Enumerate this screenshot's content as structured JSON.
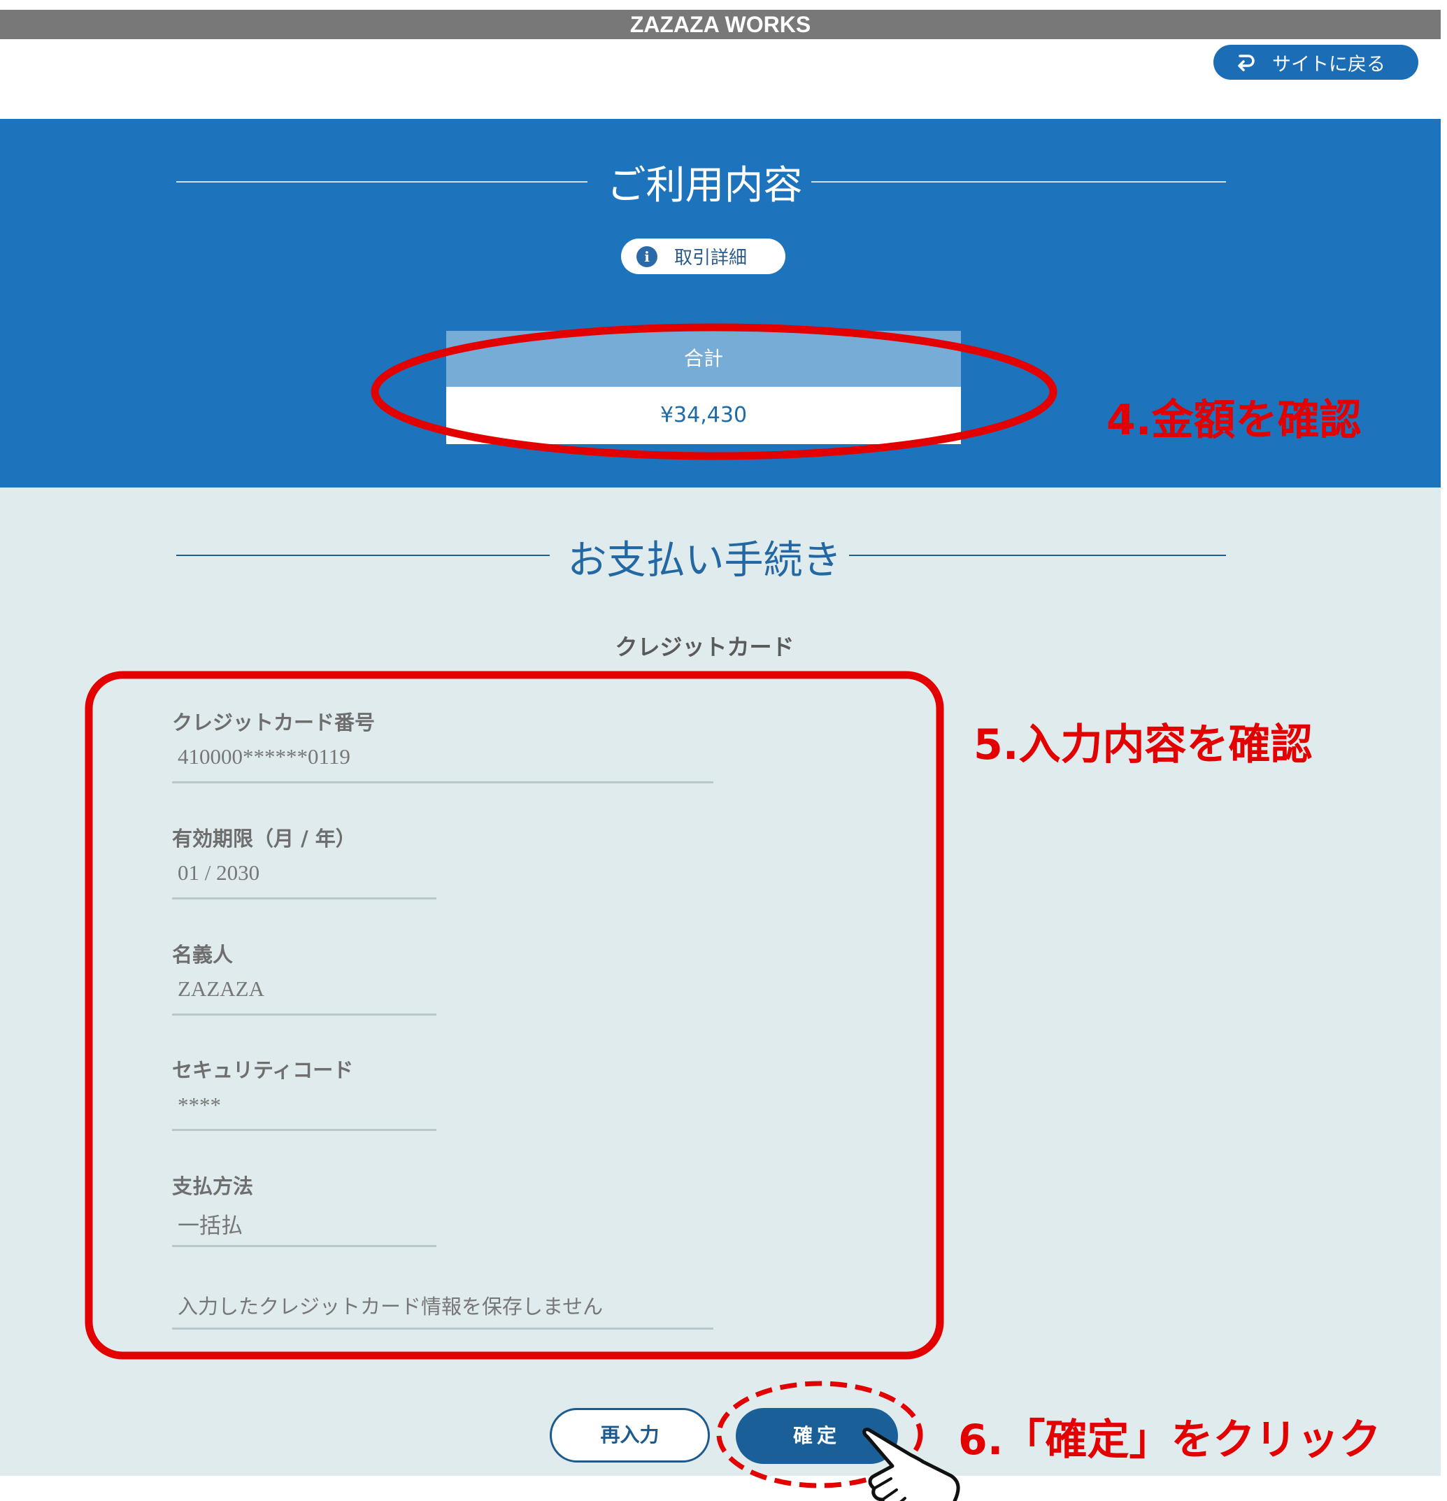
{
  "header": {
    "site_title": "ZAZAZA WORKS",
    "back_label": "サイトに戻る"
  },
  "summary": {
    "title": "ご利用内容",
    "detail_label": "取引詳細",
    "total_label": "合計",
    "total_value": "¥34,430"
  },
  "payment": {
    "title": "お支払い手続き",
    "method": "クレジットカード",
    "fields": [
      {
        "label": "クレジットカード番号",
        "value": "410000******0119"
      },
      {
        "label": "有効期限（月 / 年）",
        "value": "01 / 2030"
      },
      {
        "label": "名義人",
        "value": "ZAZAZA"
      },
      {
        "label": "セキュリティコード",
        "value": "****"
      },
      {
        "label": "支払方法",
        "value": "一括払"
      }
    ],
    "save_note": "入力したクレジットカード情報を保存しません",
    "reenter_label": "再入力",
    "confirm_label": "確定"
  },
  "annotations": {
    "step4": "4.金額を確認",
    "step5": "5.入力内容を確認",
    "step6": "6.「確定」をクリック"
  },
  "colors": {
    "accent_blue": "#1e74bc",
    "annotation_red": "#e30000",
    "panel_bg": "#e0ebee"
  }
}
